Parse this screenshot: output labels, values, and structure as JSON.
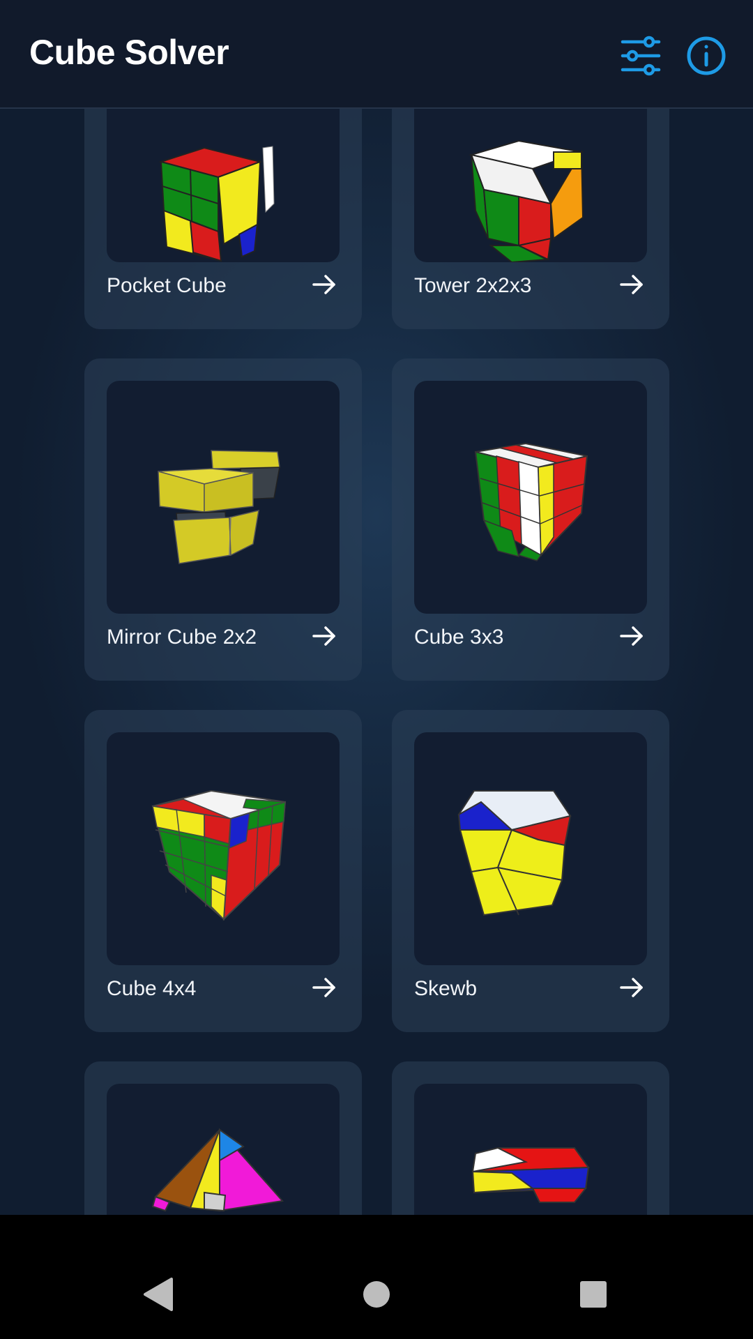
{
  "app_bar": {
    "title": "Cube Solver",
    "actions": [
      {
        "icon": "sliders-icon",
        "color": "#1e9be6"
      },
      {
        "icon": "info-icon",
        "color": "#1e9be6"
      }
    ]
  },
  "puzzles": [
    {
      "name": "Pocket Cube",
      "icon": "arrow-right-icon"
    },
    {
      "name": "Tower 2x2x3",
      "icon": "arrow-right-icon"
    },
    {
      "name": "Mirror Cube 2x2",
      "icon": "arrow-right-icon"
    },
    {
      "name": "Cube 3x3",
      "icon": "arrow-right-icon"
    },
    {
      "name": "Cube 4x4",
      "icon": "arrow-right-icon"
    },
    {
      "name": "Skewb",
      "icon": "arrow-right-icon"
    },
    {
      "name": "",
      "icon": "pyraminx-thumbnail"
    },
    {
      "name": "",
      "icon": "megaminx-thumbnail"
    }
  ],
  "system_nav": {
    "buttons": [
      "back-icon",
      "home-icon",
      "recents-icon"
    ],
    "color": "#bdbdbd"
  },
  "colors": {
    "accent": "#1e9be6",
    "background": "#152438",
    "card": "#26374e",
    "thumbnail": "#121d31"
  }
}
